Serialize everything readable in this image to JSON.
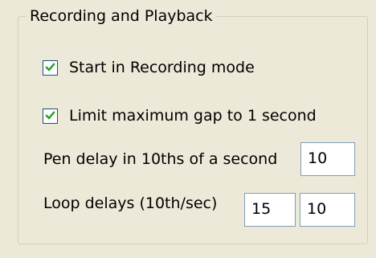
{
  "group": {
    "title": "Recording and Playback"
  },
  "start_recording": {
    "label": "Start in Recording mode",
    "checked": true
  },
  "limit_gap": {
    "label": "Limit maximum gap to 1 second",
    "checked": true
  },
  "pen_delay": {
    "label": "Pen delay in 10ths of a second",
    "value": "10"
  },
  "loop_delays": {
    "label": "Loop delays (10th/sec)",
    "value_1": "15",
    "value_2": "10"
  },
  "colors": {
    "panel_background": "#ece9d8",
    "groupbox_border": "#d0d0bf",
    "checkbox_border": "#1c5180",
    "textbox_border": "#7f9db9",
    "check_mark": "#21a121"
  },
  "icons": {
    "check": "check-mark-icon"
  }
}
